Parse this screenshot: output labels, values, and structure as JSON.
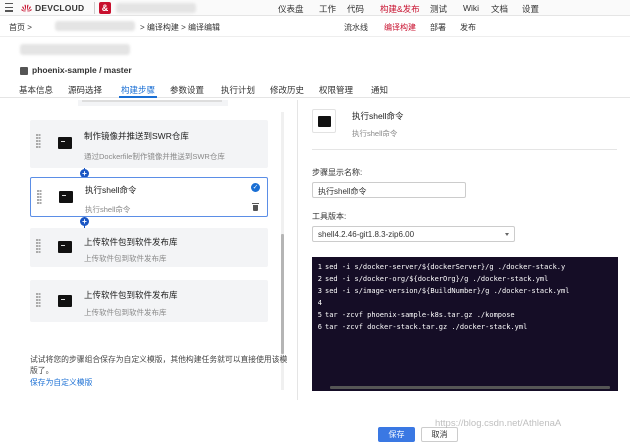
{
  "topbar": {
    "brand": "DEVCLOUD",
    "project_icon": "&",
    "nav": [
      "仪表盘",
      "工作",
      "代码",
      "构建&发布",
      "测试",
      "Wiki",
      "文档",
      "设置"
    ],
    "nav_active_index": 3
  },
  "breadcrumb": {
    "home": "首页 >",
    "path": "> 编译构建 > 编译编辑"
  },
  "subnav": [
    "流水线",
    "编译构建",
    "部署",
    "发布"
  ],
  "repo": {
    "name": "phoenix-sample / master"
  },
  "tabs": [
    "基本信息",
    "源码选择",
    "构建步骤",
    "参数设置",
    "执行计划",
    "修改历史",
    "权限管理",
    "通知"
  ],
  "active_tab_index": 2,
  "steps": [
    {
      "title": "制作镜像并推送到SWR仓库",
      "desc": "通过Dockerfile制作镜像并推送到SWR仓库",
      "selected": false
    },
    {
      "title": "执行shell命令",
      "desc": "执行shell命令",
      "selected": true
    },
    {
      "title": "上传软件包到软件发布库",
      "desc": "上传软件包到软件发布库",
      "selected": false
    },
    {
      "title": "上传软件包到软件发布库",
      "desc": "上传软件包到软件发布库",
      "selected": false
    }
  ],
  "hint": {
    "text": "试试将您的步骤组合保存为自定义模版，其他构建任务就可以直接使用该模版了。",
    "link": "保存为自定义模版"
  },
  "detail": {
    "title": "执行shell命令",
    "subtitle": "执行shell命令",
    "name_label": "步骤显示名称:",
    "name_value": "执行shell命令",
    "tool_label": "工具版本:",
    "tool_value": "shell4.2.46-git1.8.3-zip6.00"
  },
  "code_lines": [
    {
      "n": "1",
      "text": "sed -i s/docker-server/${dockerServer}/g ./docker-stack.y"
    },
    {
      "n": "2",
      "text": "sed -i s/docker-org/${dockerOrg}/g ./docker-stack.yml"
    },
    {
      "n": "3",
      "text": "sed -i s/image-version/${BuildNumber}/g ./docker-stack.yml"
    },
    {
      "n": "4",
      "text": ""
    },
    {
      "n": "5",
      "text": "tar -zcvf phoenix-sample-k8s.tar.gz ./kompose"
    },
    {
      "n": "6",
      "text": "tar -zcvf docker-stack.tar.gz ./docker-stack.yml"
    }
  ],
  "footer": {
    "save": "保存",
    "cancel": "取消"
  },
  "watermark": "https://blog.csdn.net/AthlenaA",
  "colors": {
    "brand_red": "#c8102e",
    "accent_blue": "#1a6fd4",
    "code_bg": "#150d26"
  }
}
